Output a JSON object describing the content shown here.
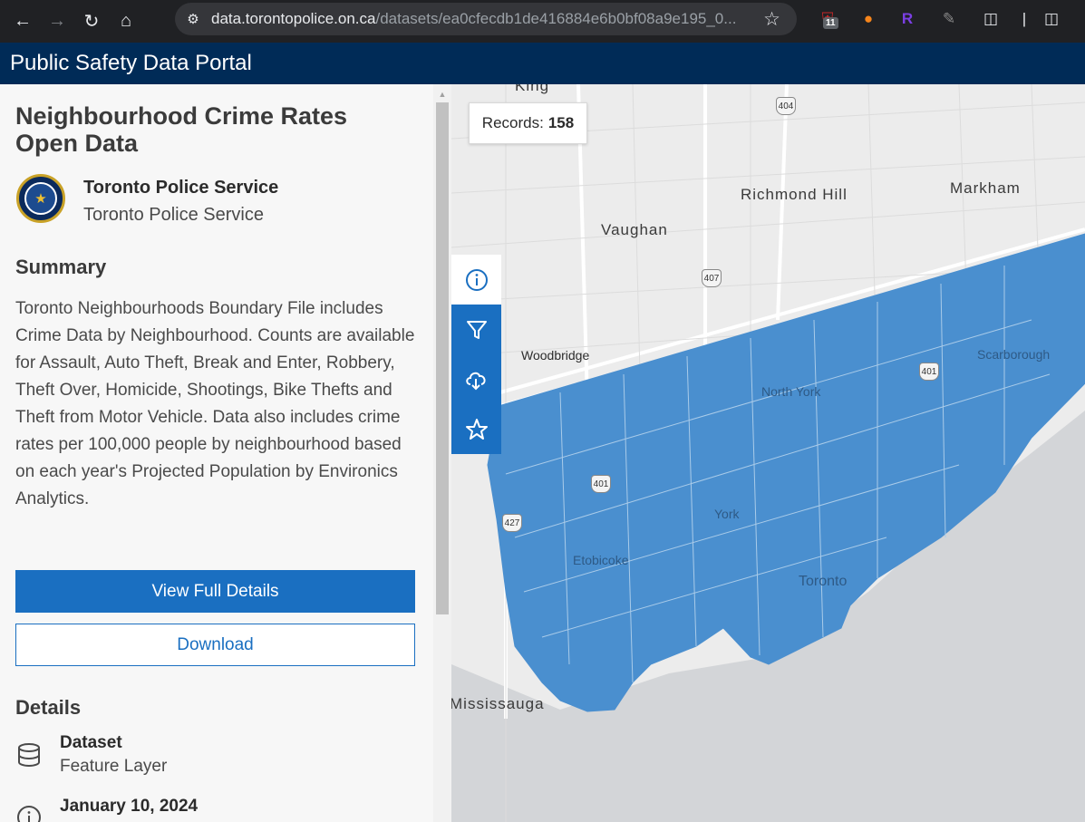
{
  "browser": {
    "url_host": "data.torontopolice.on.ca",
    "url_path": "/datasets/ea0cfecdb1de416884e6b0bf08a9e195_0...",
    "extension_badge": "11"
  },
  "header": {
    "title": "Public Safety Data Portal"
  },
  "dataset": {
    "title": "Neighbourhood Crime Rates Open Data",
    "owner_name": "Toronto Police Service",
    "owner_org": "Toronto Police Service",
    "summary_heading": "Summary",
    "summary": "Toronto Neighbourhoods Boundary File includes Crime Data by Neighbourhood. Counts are available for Assault, Auto Theft, Break and Enter, Robbery, Theft Over, Homicide, Shootings, Bike Thefts and Theft from Motor Vehicle. Data also includes crime rates per 100,000 people by neighbourhood based on each year's Projected Population by Environics Analytics.",
    "view_details_label": "View Full Details",
    "download_label": "Download",
    "details_heading": "Details",
    "details": [
      {
        "title": "Dataset",
        "sub": "Feature Layer",
        "icon": "database-icon"
      },
      {
        "title": "January 10, 2024",
        "sub": "",
        "icon": "info-icon"
      }
    ]
  },
  "map": {
    "records_label": "Records:",
    "records_count": "158",
    "labels": {
      "king": "King",
      "richmond_hill": "Richmond Hill",
      "markham": "Markham",
      "vaughan": "Vaughan",
      "woodbridge": "Woodbridge",
      "north_york": "North York",
      "scarborough": "Scarborough",
      "york": "York",
      "etobicoke": "Etobicoke",
      "toronto": "Toronto",
      "mississauga": "Mississauga"
    },
    "shields": {
      "s404": "404",
      "s407": "407",
      "s401": "401",
      "s427": "427",
      "s401b": "401"
    },
    "colors": {
      "neighbourhood_fill": "#4a8fcf",
      "lake": "#d3d5d8",
      "land": "#ececec"
    }
  },
  "toolbar": {
    "items": [
      "info-icon",
      "filter-icon",
      "cloud-download-icon",
      "star-icon"
    ]
  }
}
